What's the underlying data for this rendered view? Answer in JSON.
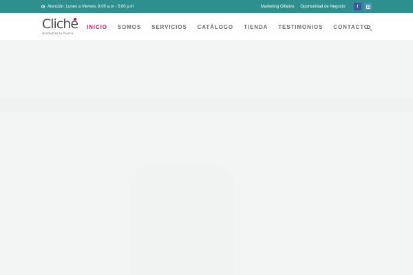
{
  "topbar": {
    "hours": "Atención: Lunes a Viernes, 8:00 a.m - 5:00 p.m",
    "links": [
      "Marketing Olfativo",
      "Oportunidad de Negocio"
    ],
    "social": {
      "facebook": "f"
    }
  },
  "logo": {
    "name": "Cliché",
    "tagline": "Aromatiza tu marca"
  },
  "nav": {
    "items": [
      {
        "label": "INICIO",
        "active": true
      },
      {
        "label": "SOMOS"
      },
      {
        "label": "SERVICIOS"
      },
      {
        "label": "CATÁLOGO"
      },
      {
        "label": "TIENDA"
      },
      {
        "label": "TESTIMONIOS"
      },
      {
        "label": "CONTACTO"
      }
    ]
  },
  "colors": {
    "topbar": "#2e8f8f",
    "accent": "#c2185b",
    "facebook": "#3b5998",
    "instagram": "#4a90b8"
  },
  "icons": [
    "clock-icon",
    "facebook-icon",
    "instagram-icon",
    "search-icon"
  ]
}
